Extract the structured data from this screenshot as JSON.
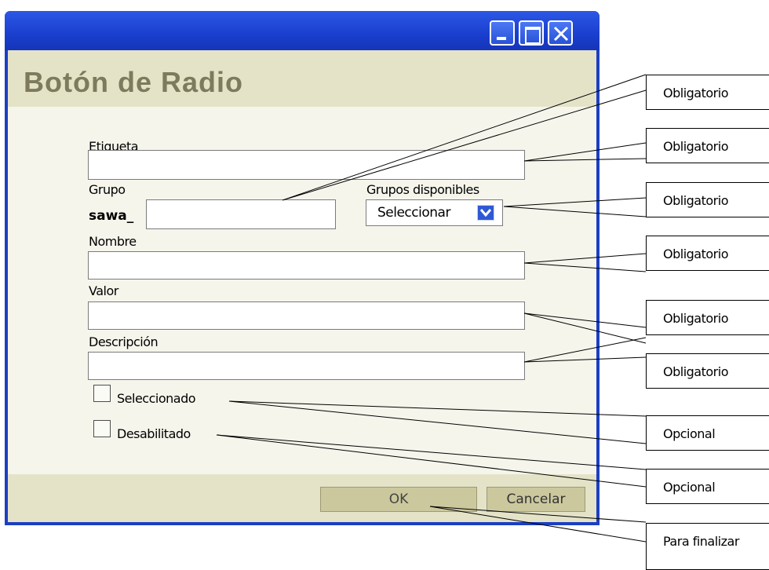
{
  "window": {
    "title": "Botón de Radio",
    "buttons": [
      "minimize-icon",
      "maximize-icon",
      "close-icon"
    ],
    "colors": {
      "titlebar": "#1c3fc2",
      "header": "#e4e3c8",
      "body": "#f6f5ec",
      "button": "#cbc89e",
      "title_text": "#7e7a5c"
    }
  },
  "form": {
    "etiqueta_label": "Etiqueta",
    "grupo_label": "Grupo",
    "grupo_prefix": "sawa_",
    "grupos_disponibles_label": "Grupos disponibles",
    "grupos_select_value": "Seleccionar",
    "nombre_label": "Nombre",
    "valor_label": "Valor",
    "descripcion_label": "Descripción",
    "seleccionado_label": "Seleccionado",
    "deshabilitado_label": "Desabilitado"
  },
  "actions": {
    "ok_label": "OK",
    "cancel_label": "Cancelar"
  },
  "callouts": [
    "Obligatorio",
    "Obligatorio",
    "Obligatorio",
    "Obligatorio",
    "Obligatorio",
    "Obligatorio",
    "Opcional",
    "Opcional",
    "Para finalizar"
  ]
}
